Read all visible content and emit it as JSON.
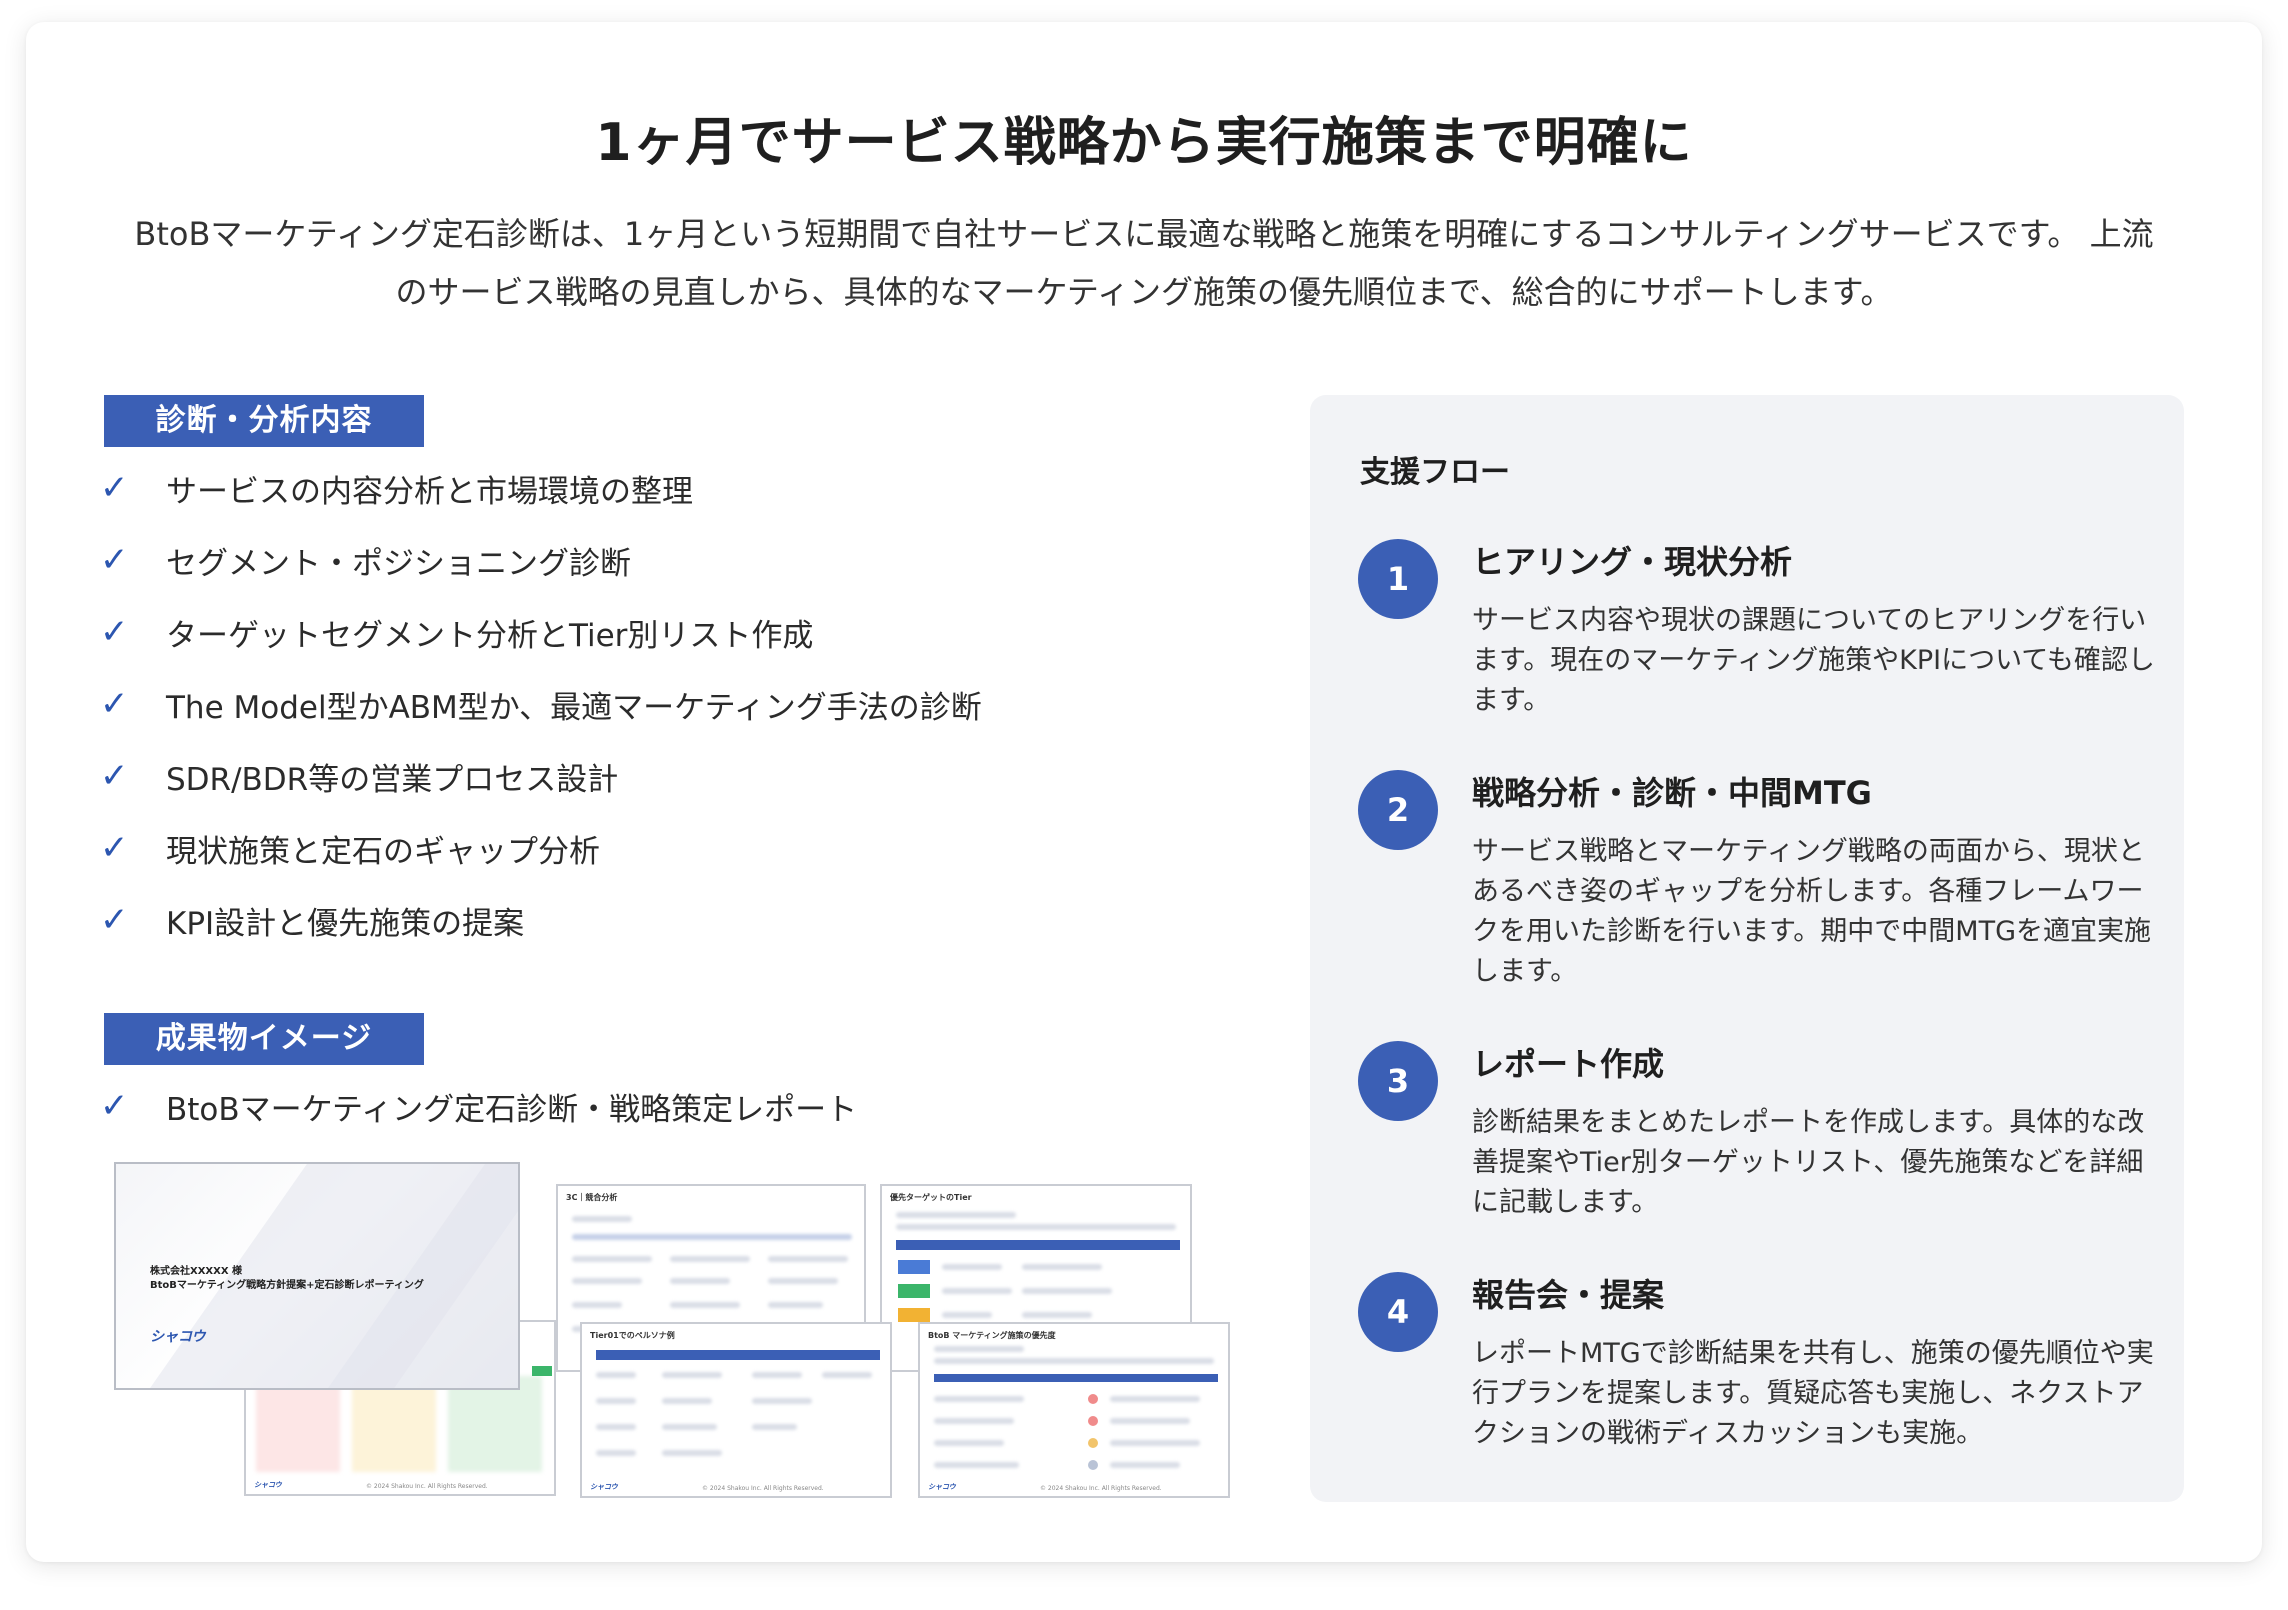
{
  "header": {
    "title": "1ヶ月でサービス戦略から実行施策まで明確に",
    "intro": "BtoBマーケティング定石診断は、1ヶ月という短期間で自社サービスに最適な戦略と施策を明確にするコンサルティングサービスです。 上流のサービス戦略の見直しから、具体的なマーケティング施策の優先順位まで、総合的にサポートします。"
  },
  "analysis": {
    "label": "診断・分析内容",
    "items": [
      "サービスの内容分析と市場環境の整理",
      "セグメント・ポジショニング診断",
      "ターゲットセグメント分析とTier別リスト作成",
      "The Model型かABM型か、最適マーケティング手法の診断",
      "SDR/BDR等の営業プロセス設計",
      "現状施策と定石のギャップ分析",
      "KPI設計と優先施策の提案"
    ]
  },
  "deliverables": {
    "label": "成果物イメージ",
    "items": [
      "BtoBマーケティング定石診断・戦略策定レポート"
    ],
    "check_glyph": "✓",
    "cover": {
      "client": "株式会社XXXXX 様",
      "subtitle": "BtoBマーケティング戦略方針提案+定石診断レポーティング",
      "logo": "シャコウ"
    },
    "slides": [
      {
        "title": "3C｜競合分析"
      },
      {
        "title": "優先ターゲットのTier"
      },
      {
        "title": "Tier01でのペルソナ例"
      },
      {
        "title": "BtoB マーケティング施策の優先度"
      }
    ],
    "footer_logo": "シャコウ",
    "footer_text": "© 2024 Shakou Inc. All Rights Reserved."
  },
  "flow": {
    "title": "支援フロー",
    "steps": [
      {
        "num": "1",
        "title": "ヒアリング・現状分析",
        "desc": "サービス内容や現状の課題についてのヒアリングを行います。現在のマーケティング施策やKPIについても確認します。"
      },
      {
        "num": "2",
        "title": "戦略分析・診断・中間MTG",
        "desc": "サービス戦略とマーケティング戦略の両面から、現状とあるべき姿のギャップを分析します。各種フレームワークを用いた診断を行います。期中で中間MTGを適宜実施します。"
      },
      {
        "num": "3",
        "title": "レポート作成",
        "desc": "診断結果をまとめたレポートを作成します。具体的な改善提案やTier別ターゲットリスト、優先施策などを詳細に記載します。"
      },
      {
        "num": "4",
        "title": "報告会・提案",
        "desc": "レポートMTGで診断結果を共有し、施策の優先順位や実行プランを提案します。質疑応答も実施し、ネクストアクションの戦術ディスカッションも実施。"
      }
    ]
  },
  "colors": {
    "accent": "#3b5fb5",
    "panel_bg": "#f2f3f6"
  }
}
